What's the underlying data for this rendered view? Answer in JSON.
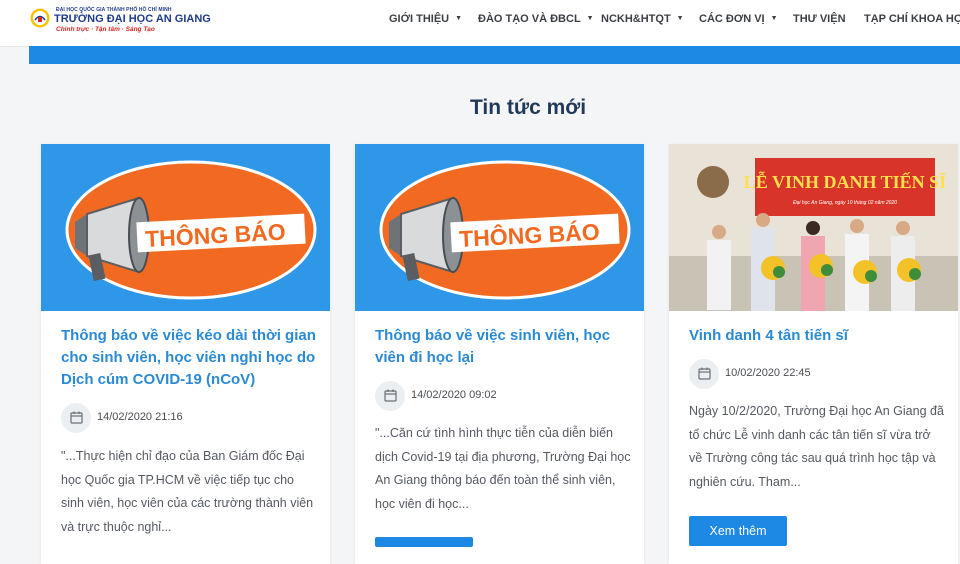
{
  "header": {
    "logo": {
      "university_line": "ĐẠI HỌC QUỐC GIA THÀNH PHỐ HỒ CHÍ MINH",
      "title": "TRƯỜNG ĐẠI HỌC AN GIANG",
      "motto": "Chính trực · Tận tâm · Sáng Tạo"
    },
    "nav": [
      {
        "label": "GIỚI THIỆU",
        "has_dropdown": true
      },
      {
        "label": "ĐÀO TẠO VÀ ĐBCL",
        "has_dropdown": true
      },
      {
        "label": "NCKH&HTQT",
        "has_dropdown": true
      },
      {
        "label": "CÁC ĐƠN VỊ",
        "has_dropdown": true
      },
      {
        "label": "THƯ VIỆN",
        "has_dropdown": false
      },
      {
        "label": "TẠP CHÍ KHOA HỌC",
        "has_dropdown": false
      }
    ]
  },
  "section": {
    "title": "Tin tức mới"
  },
  "cards": [
    {
      "image": {
        "kind": "announcement",
        "text": "THÔNG BÁO"
      },
      "title": "Thông báo về việc kéo dài thời gian cho sinh viên, học viên nghỉ học do Dịch cúm COVID-19 (nCoV)",
      "date": "14/02/2020 21:16",
      "excerpt": "\"...Thực hiện chỉ đạo của Ban Giám đốc Đại học Quốc gia TP.HCM về việc tiếp tục cho sinh viên, học viên của các trường thành viên và trực thuộc nghỉ..."
    },
    {
      "image": {
        "kind": "announcement",
        "text": "THÔNG BÁO"
      },
      "title": "Thông báo về việc sinh viên, học viên đi học lại",
      "date": "14/02/2020 09:02",
      "excerpt": "\"...Căn cứ tình hình thực tiễn của diễn biến dịch Covid-19 tại địa phương, Trường Đại học An Giang thông báo đến toàn thể sinh viên, học viên đi học..."
    },
    {
      "image": {
        "kind": "photo",
        "banner": "LỄ VINH DANH TIẾN SĨ",
        "banner_sub": "Đại học An Giang, ngày 10 tháng 02 năm 2020"
      },
      "title": "Vinh danh 4 tân tiến sĩ",
      "date": "10/02/2020 22:45",
      "excerpt": "Ngày 10/2/2020, Trường Đại học An Giang đã tổ chức Lễ vinh danh các tân tiến sĩ vừa trở về Trường công tác sau quá trình học tập và nghiên cứu. Tham...",
      "button": "Xem thêm"
    }
  ],
  "icons": {
    "date": "calendar-icon",
    "dropdown": "chevron-down-icon"
  },
  "colors": {
    "accent": "#1e88e5",
    "title_link": "#2a8ad4",
    "heading": "#213a57",
    "announcement_orange": "#f26a21"
  }
}
